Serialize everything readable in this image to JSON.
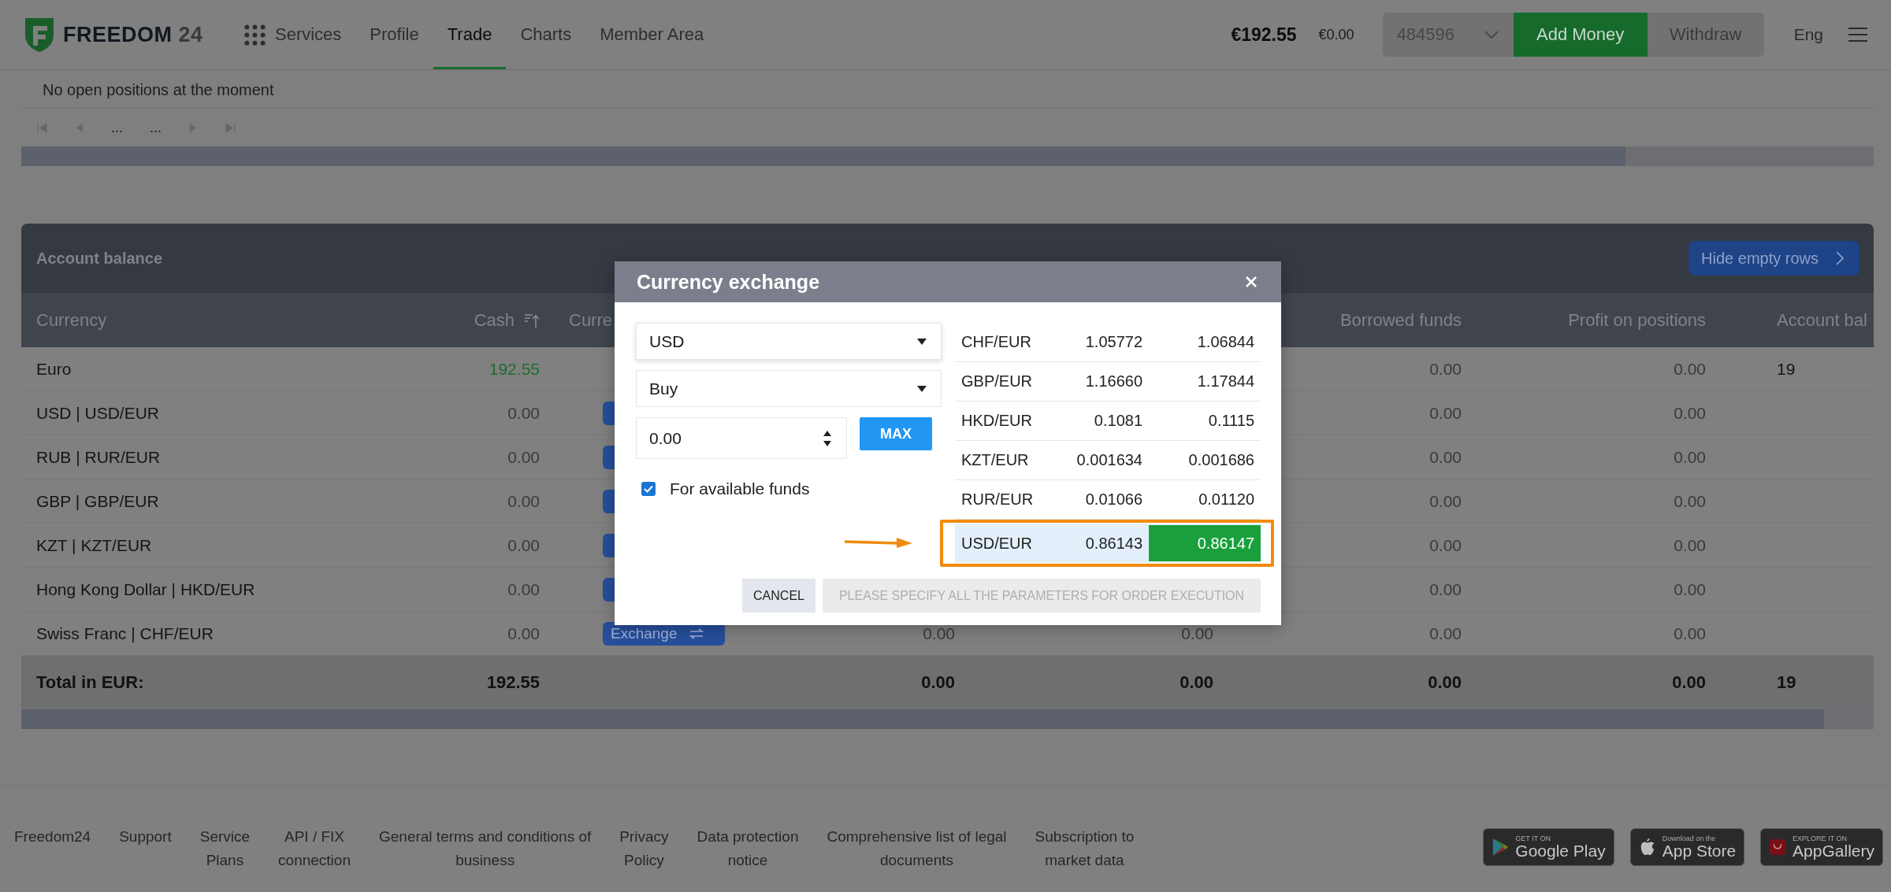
{
  "header": {
    "logo": {
      "word": "FREEDOM",
      "number": "24"
    },
    "nav": [
      {
        "label": "Services",
        "kind": "menu",
        "selected": false
      },
      {
        "label": "Profile",
        "kind": "link",
        "selected": false
      },
      {
        "label": "Trade",
        "kind": "link",
        "selected": true
      },
      {
        "label": "Charts",
        "kind": "link",
        "selected": false
      },
      {
        "label": "Member Area",
        "kind": "link",
        "selected": false
      }
    ],
    "balance": "€192.55",
    "secondary_balance": "€0.00",
    "account": "484596",
    "buttons": [
      {
        "label": "Add Money",
        "kind": "primary"
      },
      {
        "label": "Withdraw",
        "kind": "secondary"
      }
    ],
    "language": "Eng"
  },
  "positions": {
    "message": "No open positions at the moment",
    "pagination": [
      "...",
      "..."
    ]
  },
  "balance_table": {
    "title": "Account balance",
    "hide_button": "Hide empty rows",
    "columns": {
      "currency": {
        "label": "Currency",
        "sorted": false
      },
      "cash": {
        "label": "Cash",
        "sorted": true
      },
      "column_3": {
        "label": "Curre"
      },
      "borrowed_funds": {
        "label": "Borrowed funds",
        "sorted": false
      },
      "profit_on_positions": {
        "label": "Profit on positions",
        "sorted": false
      },
      "column_8": {
        "label": "Account bal"
      }
    },
    "rows": [
      {
        "currency": "Euro",
        "cash": "192.55",
        "borrowed_funds": "0.00",
        "profit_on_positions": "0.00",
        "column_8": "19",
        "positive": true,
        "exchange": false
      },
      {
        "currency": "USD | USD/EUR",
        "cash": "0.00",
        "borrowed_funds": "0.00",
        "profit_on_positions": "0.00",
        "positive": false,
        "exchange": true
      },
      {
        "currency": "RUB | RUR/EUR",
        "cash": "0.00",
        "borrowed_funds": "0.00",
        "profit_on_positions": "0.00",
        "positive": false,
        "exchange": true
      },
      {
        "currency": "GBP | GBP/EUR",
        "cash": "0.00",
        "borrowed_funds": "0.00",
        "profit_on_positions": "0.00",
        "positive": false,
        "exchange": true
      },
      {
        "currency": "KZT | KZT/EUR",
        "cash": "0.00",
        "borrowed_funds": "0.00",
        "profit_on_positions": "0.00",
        "positive": false,
        "exchange": true
      },
      {
        "currency": "Hong Kong Dollar | HKD/EUR",
        "cash": "0.00",
        "borrowed_funds": "0.00",
        "profit_on_positions": "0.00",
        "positive": false,
        "exchange": true
      },
      {
        "currency": "Swiss Franc | CHF/EUR",
        "cash": "0.00",
        "column_4": "0.00",
        "column_5": "0.00",
        "borrowed_funds": "0.00",
        "profit_on_positions": "0.00",
        "positive": false,
        "exchange": true,
        "exchange_label": "Exchange"
      }
    ],
    "total": {
      "currency": "Total in EUR:",
      "cash": "192.55",
      "column_4": "0.00",
      "column_5": "0.00",
      "borrowed_funds": "0.00",
      "profit_on_positions": "0.00",
      "column_8": "19"
    }
  },
  "modal": {
    "title": "Currency exchange",
    "currency": "USD",
    "side": "Buy",
    "amount": "0.00",
    "max_button": "MAX",
    "available_funds": {
      "label": "For available funds",
      "checked": true
    },
    "rates": [
      {
        "pair": "CHF/EUR",
        "bid": "1.05772",
        "ask": "1.06844",
        "selected": false,
        "annotated": false
      },
      {
        "pair": "GBP/EUR",
        "bid": "1.16660",
        "ask": "1.17844",
        "selected": false,
        "annotated": false
      },
      {
        "pair": "HKD/EUR",
        "bid": "0.1081",
        "ask": "0.1115",
        "selected": false,
        "annotated": false
      },
      {
        "pair": "KZT/EUR",
        "bid": "0.001634",
        "ask": "0.001686",
        "selected": false,
        "annotated": false
      },
      {
        "pair": "RUR/EUR",
        "bid": "0.01066",
        "ask": "0.01120",
        "selected": false,
        "annotated": false
      },
      {
        "pair": "USD/EUR",
        "bid": "0.86143",
        "ask": "0.86147",
        "selected": true,
        "annotated": true
      }
    ],
    "cancel": "CANCEL",
    "submit": {
      "label": "PLEASE SPECIFY ALL THE PARAMETERS FOR ORDER EXECUTION",
      "disabled": true
    }
  },
  "footer": {
    "links": [
      {
        "lines": [
          "Freedom24"
        ]
      },
      {
        "lines": [
          "Support"
        ]
      },
      {
        "lines": [
          "Service",
          "Plans"
        ]
      },
      {
        "lines": [
          "API / FIX",
          "connection"
        ]
      },
      {
        "lines": [
          "General terms and conditions of",
          "business"
        ]
      },
      {
        "lines": [
          "Privacy",
          "Policy"
        ]
      },
      {
        "lines": [
          "Data protection",
          "notice"
        ]
      },
      {
        "lines": [
          "Comprehensive list of legal",
          "documents"
        ]
      },
      {
        "lines": [
          "Subscription to",
          "market data"
        ]
      }
    ],
    "stores": [
      {
        "kind": "google",
        "small": "GET IT ON",
        "label": "Google Play"
      },
      {
        "kind": "apple",
        "small": "Download on the",
        "label": "App Store"
      },
      {
        "kind": "huawei",
        "small": "EXPLORE IT ON",
        "label": "AppGallery"
      }
    ]
  }
}
